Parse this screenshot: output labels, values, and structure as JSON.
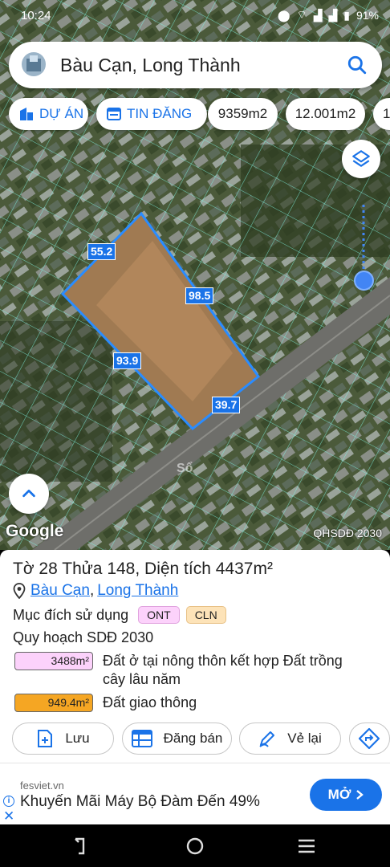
{
  "status": {
    "time": "10:24",
    "battery": "91%"
  },
  "search": {
    "value": "Bàu Cạn, Long Thành",
    "placeholder": ""
  },
  "chips": [
    {
      "label": "DỰ ÁN",
      "icon": "building-icon"
    },
    {
      "label": "TIN ĐĂNG",
      "icon": "listing-icon"
    },
    {
      "label": "9359m2"
    },
    {
      "label": "12.001m2"
    },
    {
      "label": "1"
    }
  ],
  "map": {
    "dimensions": [
      "55.2",
      "98.5",
      "93.9",
      "39.7"
    ],
    "logo": "Google",
    "mode_label": "QHSDĐ 2030",
    "watermark": "Sổ"
  },
  "parcel": {
    "title": "Tờ 28 Thửa 148, Diện tích 4437m²",
    "place_ward": "Bàu Cạn",
    "place_sep": ", ",
    "place_district": "Long Thành",
    "purpose_label": "Mục đích sử dụng",
    "purpose_codes": [
      "ONT",
      "CLN"
    ],
    "plan_title": "Quy hoạch SDĐ 2030",
    "plans": [
      {
        "area": "3488m²",
        "desc": "Đất ở tại nông thôn kết hợp Đất trồng cây lâu năm",
        "color": "#fcd2fb"
      },
      {
        "area": "949.4m²",
        "desc": "Đất giao thông",
        "color": "#f5a623"
      }
    ]
  },
  "actions": [
    {
      "label": "Lưu",
      "icon": "add-doc-icon"
    },
    {
      "label": "Đăng bán",
      "icon": "table-icon"
    },
    {
      "label": "Vẻ lại",
      "icon": "pen-icon"
    },
    {
      "label": "",
      "icon": "direction-icon"
    }
  ],
  "ad": {
    "domain": "fesviet.vn",
    "text": "Khuyến Mãi Máy Bộ Đàm Đến 49%",
    "cta": "MỞ"
  },
  "colors": {
    "accent": "#1a73e8",
    "parcel_outline": "#2a8cff"
  }
}
